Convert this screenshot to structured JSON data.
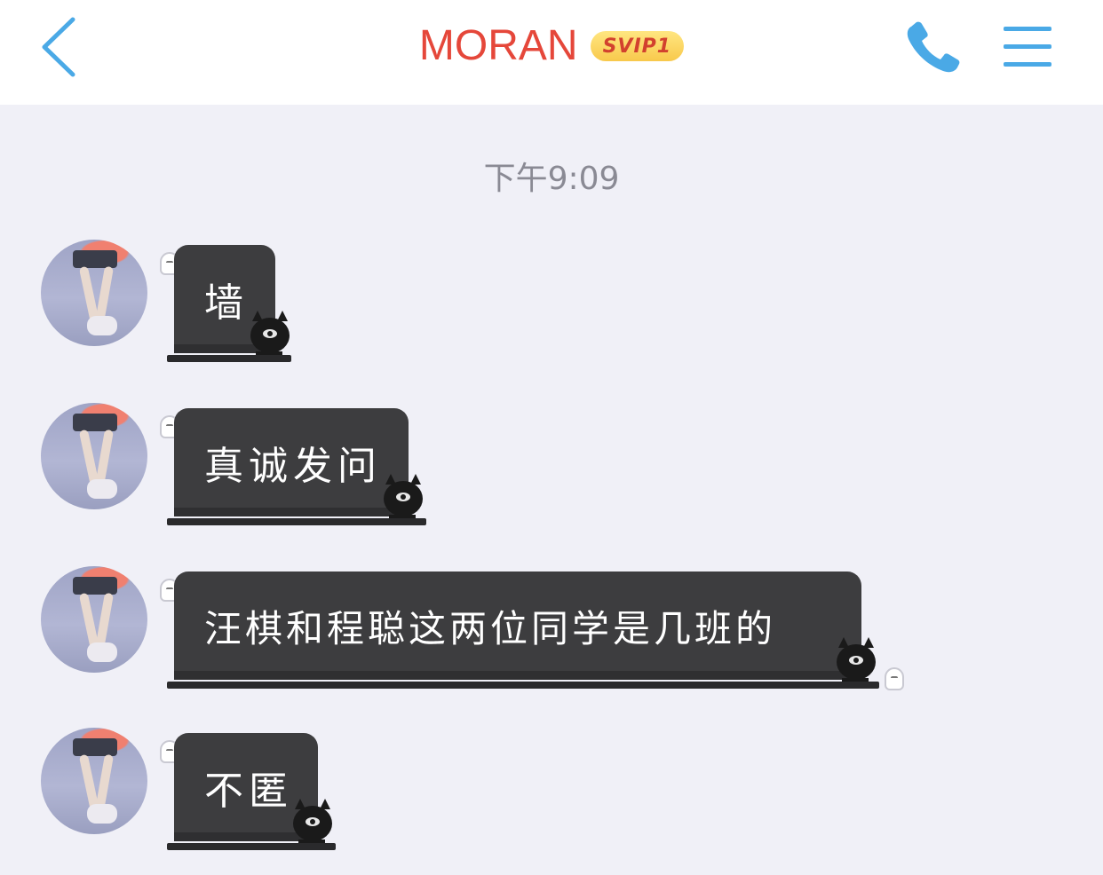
{
  "header": {
    "title": "MORAN",
    "badge": "SVIP1",
    "back_icon": "chevron-left-icon",
    "call_icon": "phone-icon",
    "menu_icon": "menu-icon",
    "accent": "#4aa9e6",
    "title_color": "#e5473a"
  },
  "chat": {
    "timestamp": "下午9:09",
    "bubble_color": "#3d3d3f",
    "messages": [
      {
        "text": "墙"
      },
      {
        "text": "真诚发问"
      },
      {
        "text": "汪棋和程聪这两位同学是几班的"
      },
      {
        "text": "不匿"
      }
    ]
  }
}
